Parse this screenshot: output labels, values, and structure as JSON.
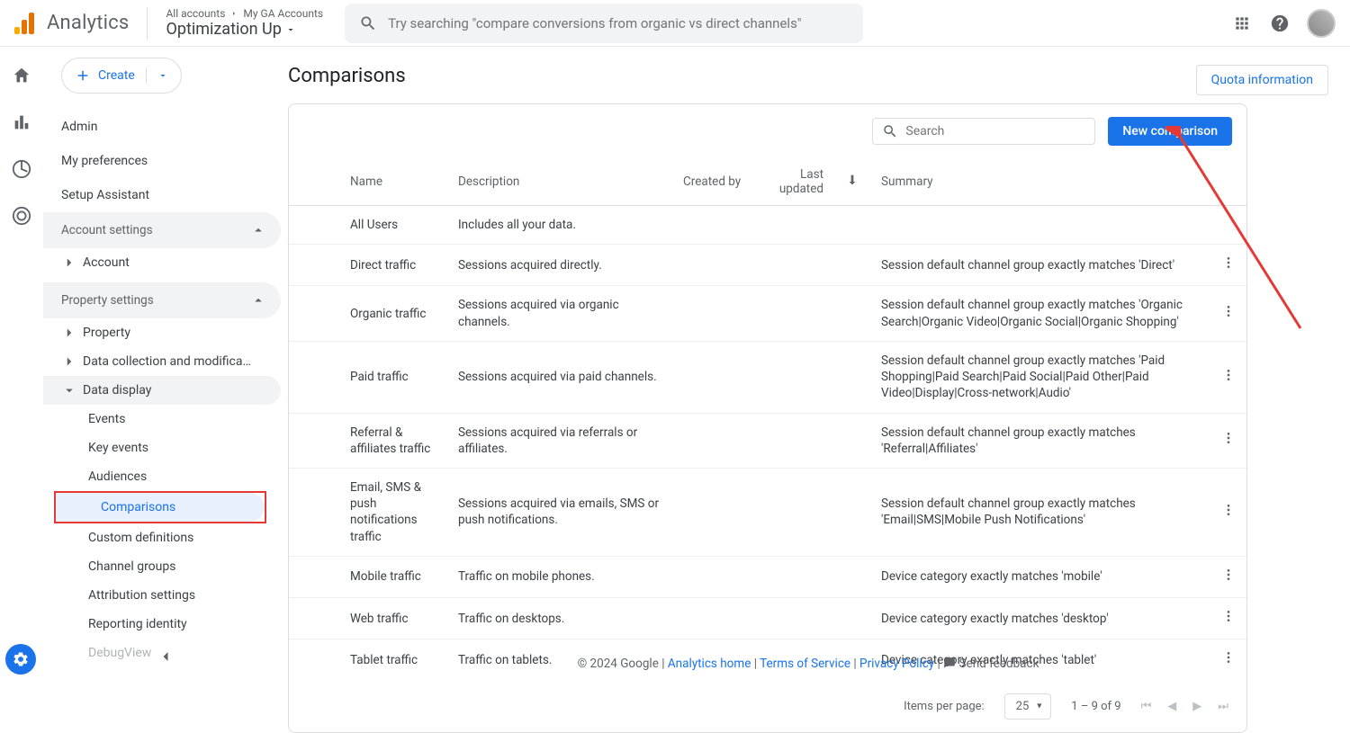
{
  "brand": "Analytics",
  "breadcrumb": {
    "all": "All accounts",
    "acct": "My GA Accounts",
    "property": "Optimization Up"
  },
  "search_placeholder": "Try searching \"compare conversions from organic vs direct channels\"",
  "sidebar": {
    "create": "Create",
    "top": [
      "Admin",
      "My preferences",
      "Setup Assistant"
    ],
    "account_settings": "Account settings",
    "account": "Account",
    "property_settings": "Property settings",
    "property": "Property",
    "data_collection": "Data collection and modifica…",
    "data_display": "Data display",
    "leaves": [
      "Events",
      "Key events",
      "Audiences",
      "Comparisons",
      "Custom definitions",
      "Channel groups",
      "Attribution settings",
      "Reporting identity",
      "DebugView"
    ]
  },
  "page": {
    "title": "Comparisons",
    "quota": "Quota information",
    "search_ph": "Search",
    "new_btn": "New comparison",
    "items_label": "Items per page:",
    "per_page": "25",
    "range": "1 – 9 of 9"
  },
  "columns": {
    "name": "Name",
    "desc": "Description",
    "created": "Created by",
    "last": "Last updated",
    "sum": "Summary"
  },
  "rows": [
    {
      "name": "All Users",
      "desc": "Includes all your data.",
      "sum": "",
      "act": false
    },
    {
      "name": "Direct traffic",
      "desc": "Sessions acquired directly.",
      "sum": "Session default channel group exactly matches 'Direct'",
      "act": true
    },
    {
      "name": "Organic traffic",
      "desc": "Sessions acquired via organic channels.",
      "sum": "Session default channel group exactly matches 'Organic Search|Organic Video|Organic Social|Organic Shopping'",
      "act": true
    },
    {
      "name": "Paid traffic",
      "desc": "Sessions acquired via paid channels.",
      "sum": "Session default channel group exactly matches 'Paid Shopping|Paid Search|Paid Social|Paid Other|Paid Video|Display|Cross-network|Audio'",
      "act": true
    },
    {
      "name": "Referral & affiliates traffic",
      "desc": "Sessions acquired via referrals or affiliates.",
      "sum": "Session default channel group exactly matches 'Referral|Affiliates'",
      "act": true
    },
    {
      "name": "Email, SMS & push notifications traffic",
      "desc": "Sessions acquired via emails, SMS or push notifications.",
      "sum": "Session default channel group exactly matches 'Email|SMS|Mobile Push Notifications'",
      "act": true
    },
    {
      "name": "Mobile traffic",
      "desc": "Traffic on mobile phones.",
      "sum": "Device category exactly matches 'mobile'",
      "act": true
    },
    {
      "name": "Web traffic",
      "desc": "Traffic on desktops.",
      "sum": "Device category exactly matches 'desktop'",
      "act": true
    },
    {
      "name": "Tablet traffic",
      "desc": "Traffic on tablets.",
      "sum": "Device category exactly matches 'tablet'",
      "act": true
    }
  ],
  "footer": {
    "copy": "© 2024 Google",
    "home": "Analytics home",
    "tos": "Terms of Service",
    "privacy": "Privacy Policy",
    "feedback": "Send feedback"
  }
}
